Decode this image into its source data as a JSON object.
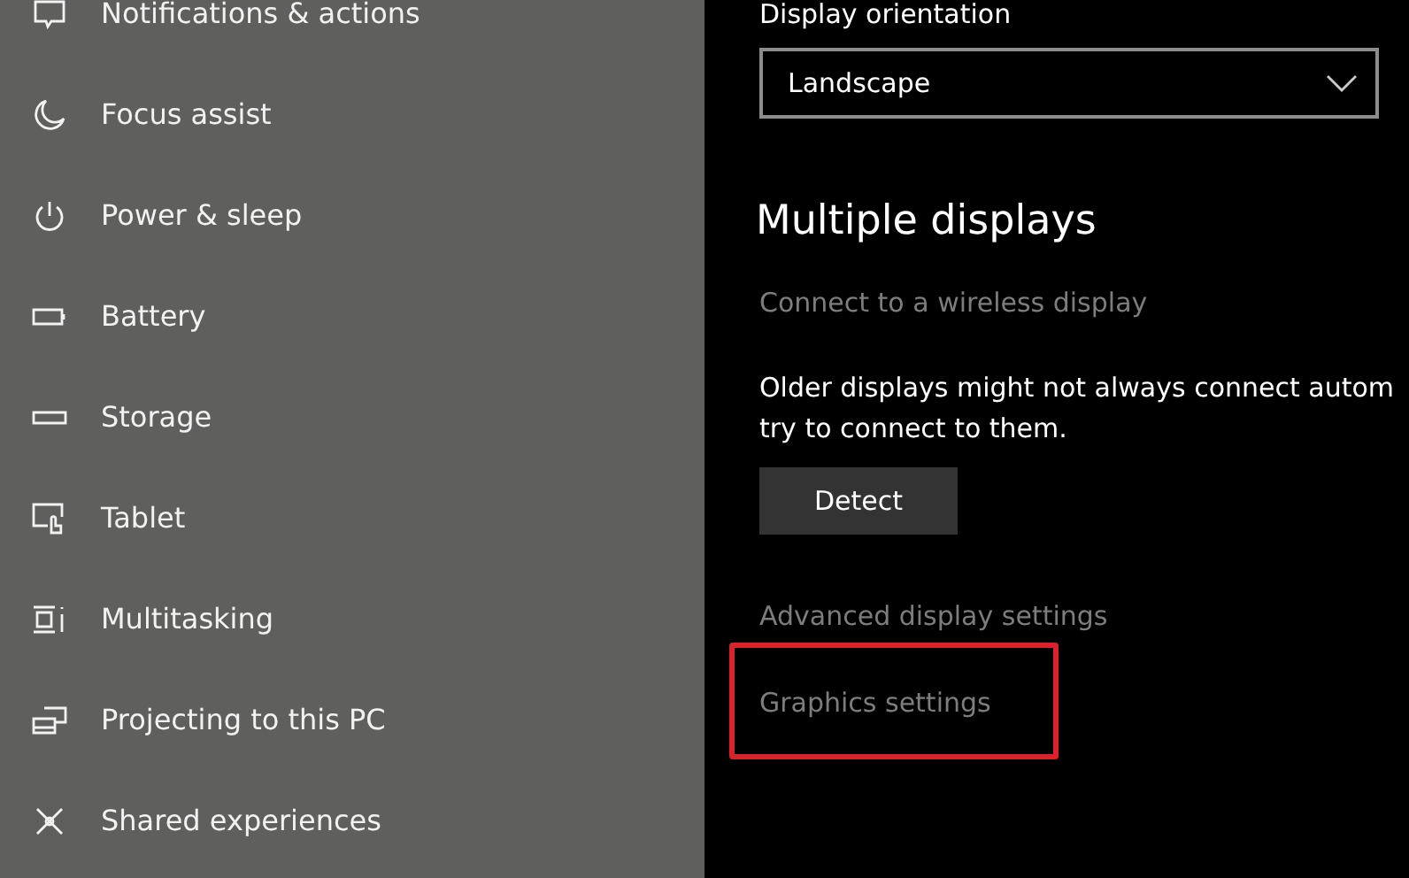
{
  "sidebar": {
    "items": [
      {
        "label": "Notifications & actions"
      },
      {
        "label": "Focus assist"
      },
      {
        "label": "Power & sleep"
      },
      {
        "label": "Battery"
      },
      {
        "label": "Storage"
      },
      {
        "label": "Tablet"
      },
      {
        "label": "Multitasking"
      },
      {
        "label": "Projecting to this PC"
      },
      {
        "label": "Shared experiences"
      }
    ]
  },
  "content": {
    "orientation_label": "Display orientation",
    "orientation_dropdown": {
      "value": "Landscape"
    },
    "section_title": "Multiple displays",
    "wireless_link": "Connect to a wireless display",
    "paragraph_lines": [
      "Older displays might not always connect autom",
      "try to connect to them."
    ],
    "detect_button": "Detect",
    "links": [
      {
        "label": "Advanced display settings",
        "highlighted": false
      },
      {
        "label": "Graphics settings",
        "highlighted": true
      }
    ]
  }
}
